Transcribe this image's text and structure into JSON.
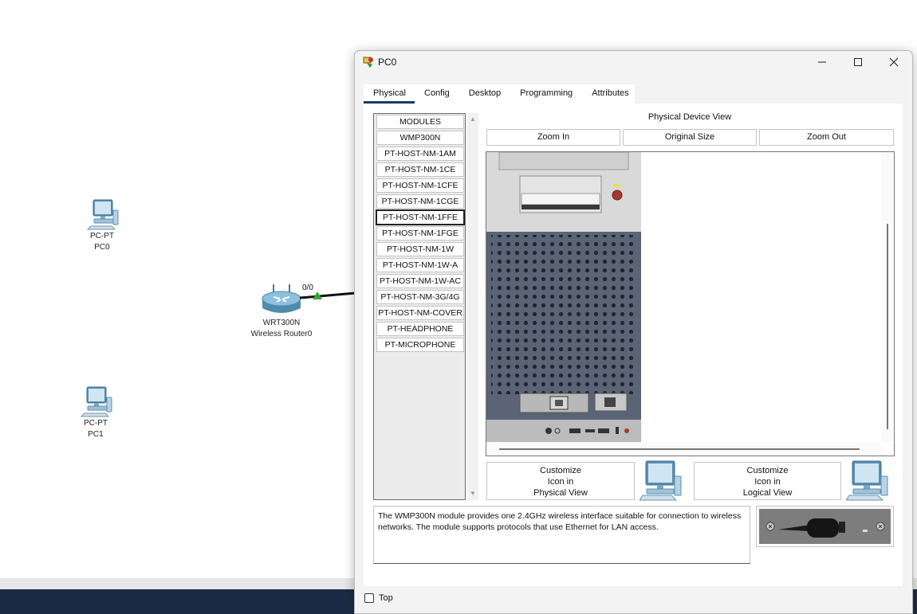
{
  "workspace": {
    "devices": [
      {
        "type": "PC-PT",
        "name": "PC0"
      },
      {
        "type": "WRT300N",
        "name": "Wireless Router0"
      },
      {
        "type": "PC-PT",
        "name": "PC1"
      }
    ],
    "port_label": "0/0"
  },
  "window": {
    "title": "PC0",
    "controls": {
      "minimize": "minimize-icon",
      "maximize": "maximize-icon",
      "close": "close-icon"
    },
    "tabs": [
      {
        "label": "Physical",
        "active": true
      },
      {
        "label": "Config",
        "active": false
      },
      {
        "label": "Desktop",
        "active": false
      },
      {
        "label": "Programming",
        "active": false
      },
      {
        "label": "Attributes",
        "active": false
      }
    ],
    "modules": [
      "MODULES",
      "WMP300N",
      "PT-HOST-NM-1AM",
      "PT-HOST-NM-1CE",
      "PT-HOST-NM-1CFE",
      "PT-HOST-NM-1CGE",
      "PT-HOST-NM-1FFE",
      "PT-HOST-NM-1FGE",
      "PT-HOST-NM-1W",
      "PT-HOST-NM-1W-A",
      "PT-HOST-NM-1W-AC",
      "PT-HOST-NM-3G/4G",
      "PT-HOST-NM-COVER",
      "PT-HEADPHONE",
      "PT-MICROPHONE"
    ],
    "selected_module": "PT-HOST-NM-1FFE",
    "physical_view": {
      "title": "Physical Device View",
      "zoom_in": "Zoom In",
      "original_size": "Original Size",
      "zoom_out": "Zoom Out"
    },
    "customize_physical": [
      "Customize",
      "Icon in",
      "Physical View"
    ],
    "customize_logical": [
      "Customize",
      "Icon in",
      "Logical View"
    ],
    "description": "The WMP300N module provides one 2.4GHz wireless interface suitable for connection to wireless networks. The module supports protocols that use Ethernet for LAN access.",
    "top_checkbox": {
      "label": "Top",
      "checked": false
    }
  },
  "colors": {
    "taskbar": "#1c2b45",
    "tab_underline": "#1b3a66",
    "link_green": "#2eaa3a"
  }
}
